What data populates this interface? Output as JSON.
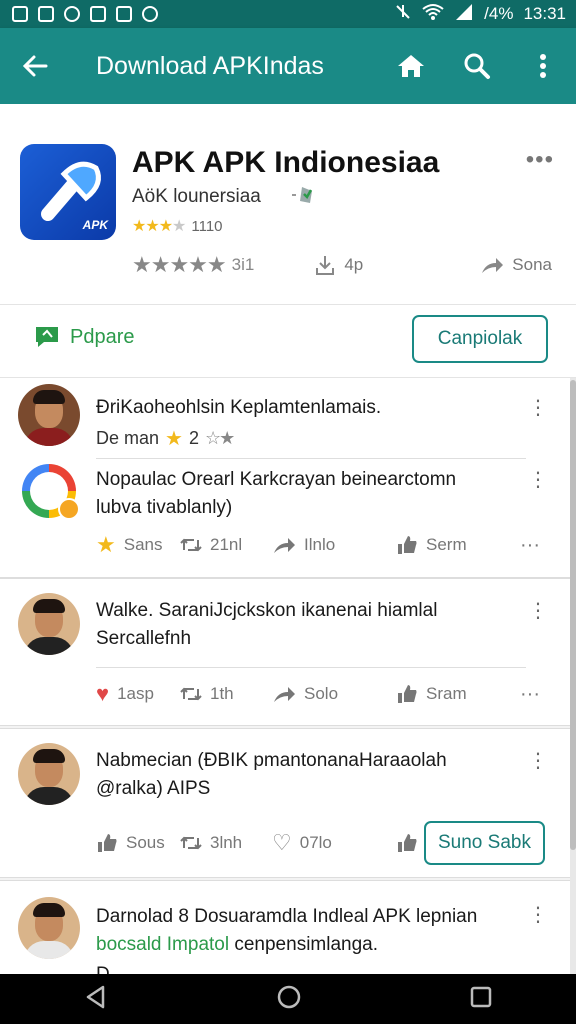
{
  "status_bar": {
    "battery": "/4%",
    "time": "13:31"
  },
  "app_bar": {
    "title": "Download APKIndas"
  },
  "app": {
    "name": "APK APK Indionesiaa",
    "developer": "AöK lounersiaa",
    "rating_small": "1110",
    "rating_stat": "3i1",
    "downloads": "4p",
    "share_label": "Sona"
  },
  "action_bar": {
    "prepare_label": "Pdpare",
    "primary_button": "Canpiolak"
  },
  "posts": [
    {
      "text": "ÐriKaoheohlsin Keplamtenlamais.",
      "sub_label": "De man",
      "sub_rating": "2",
      "reply_line1": "Nopaulac Orearl Karkcrayan beinearctomn",
      "reply_line2": "lubva tivablanly)",
      "actions": {
        "a1": "Sans",
        "a2": "21nl",
        "a3": "Ilnlo",
        "a4": "Serm",
        "more": "···"
      }
    },
    {
      "line1": "Walke. SaraniJcjckskon ikanenai hiamlal",
      "line2": "Sercallefnh",
      "actions": {
        "a1": "1asp",
        "a2": "1th",
        "a3": "Solo",
        "a4": "Sram",
        "more": "···"
      }
    },
    {
      "line1": "Nabmecian (ÐBIK pmantonanaHaraaolah",
      "line2": "@ralka) AIPS",
      "actions": {
        "a1": "Sous",
        "a2": "3lnh",
        "a3": "07lo",
        "button": "Suno Sabk"
      }
    },
    {
      "line1": "Darnolad 8 Dosuaramdla Indleal APK lepnian",
      "line2_green": "bocsald Impatol",
      "line2_rest": " cenpensimlanga.",
      "line3": "D..."
    }
  ],
  "colors": {
    "toolbar": "#1a8a86",
    "status_bar": "#0f6b66",
    "accent_green": "#2b9a4a"
  },
  "icons": [
    "back-arrow-icon",
    "home-icon",
    "search-icon",
    "more-vert-icon",
    "star-icon",
    "download-icon",
    "share-icon",
    "retweet-icon",
    "thumb-up-icon",
    "heart-icon",
    "sort-icon"
  ]
}
